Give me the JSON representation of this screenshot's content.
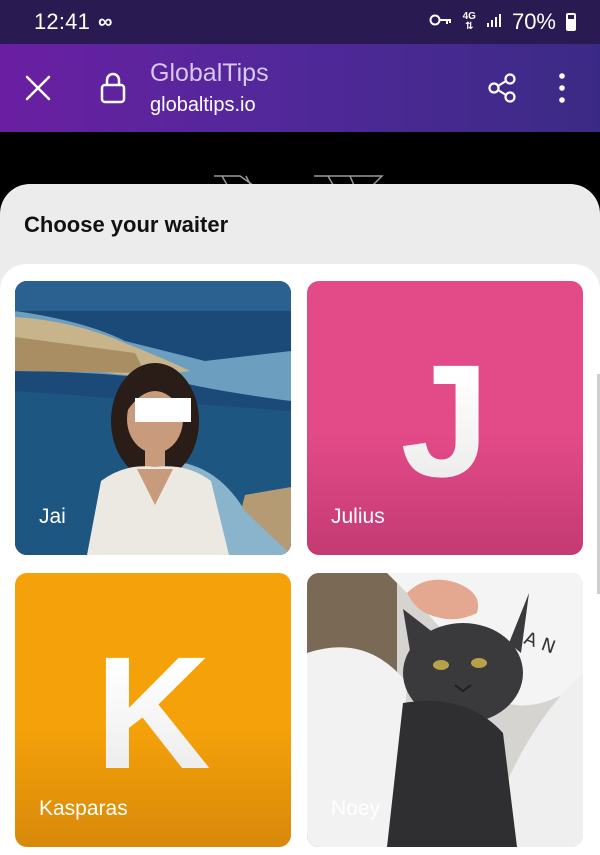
{
  "status_bar": {
    "time": "12:41",
    "network": "4G",
    "battery": "70%"
  },
  "header": {
    "title": "GlobalTips",
    "url": "globaltips.io"
  },
  "sheet": {
    "title": "Choose your waiter"
  },
  "waiters": [
    {
      "name": "Jai",
      "type": "photo"
    },
    {
      "name": "Julius",
      "type": "initial",
      "initial": "J",
      "color": "#e34b88"
    },
    {
      "name": "Kasparas",
      "type": "initial",
      "initial": "K",
      "color": "#f5a20a"
    },
    {
      "name": "Noey",
      "type": "photo"
    }
  ],
  "colors": {
    "header_start": "#6a1fa2",
    "header_end": "#3b2a85",
    "status_bar": "#2a1a52"
  }
}
